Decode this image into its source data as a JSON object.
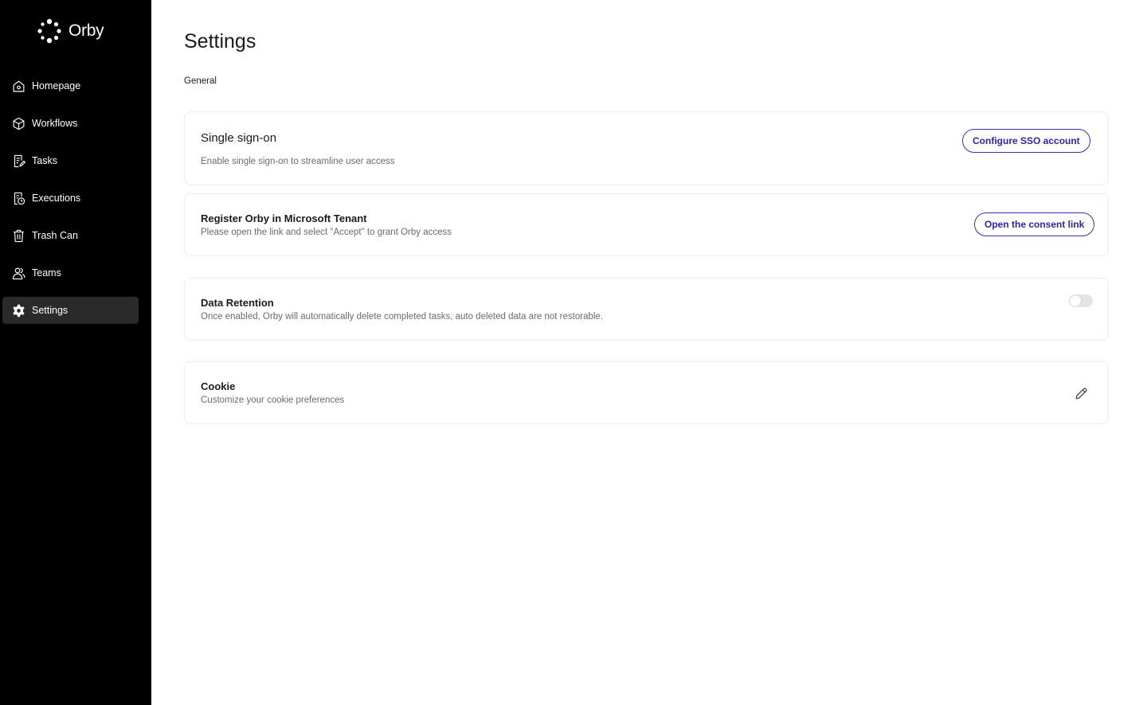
{
  "app": {
    "brand_name": "Orby"
  },
  "sidebar": {
    "items": [
      {
        "label": "Homepage",
        "icon": "home-icon"
      },
      {
        "label": "Workflows",
        "icon": "cube-icon"
      },
      {
        "label": "Tasks",
        "icon": "task-doc-icon"
      },
      {
        "label": "Executions",
        "icon": "execution-clock-icon"
      },
      {
        "label": "Trash Can",
        "icon": "trash-icon"
      },
      {
        "label": "Teams",
        "icon": "users-icon"
      },
      {
        "label": "Settings",
        "icon": "gear-icon",
        "active": true
      }
    ]
  },
  "main": {
    "title": "Settings",
    "section": "General",
    "cards": {
      "sso": {
        "title": "Single sign-on",
        "description": "Enable single sign-on to streamline user access",
        "button_label": "Configure SSO account"
      },
      "microsoft": {
        "title": "Register Orby in Microsoft Tenant",
        "description": "Please open the link and select \"Accept\" to grant Orby access",
        "button_label": "Open the consent link"
      },
      "retention": {
        "title": "Data Retention",
        "description": "Once enabled, Orby will automatically delete completed tasks, auto deleted data are not restorable.",
        "enabled": false
      },
      "cookie": {
        "title": "Cookie",
        "description": "Customize your cookie preferences",
        "action_icon": "pencil-icon"
      }
    }
  },
  "colors": {
    "sidebar_bg": "#000000",
    "active_item_bg": "#2a2a2a",
    "accent": "#2f24a8",
    "toggle_off": "#e4e4e4"
  }
}
